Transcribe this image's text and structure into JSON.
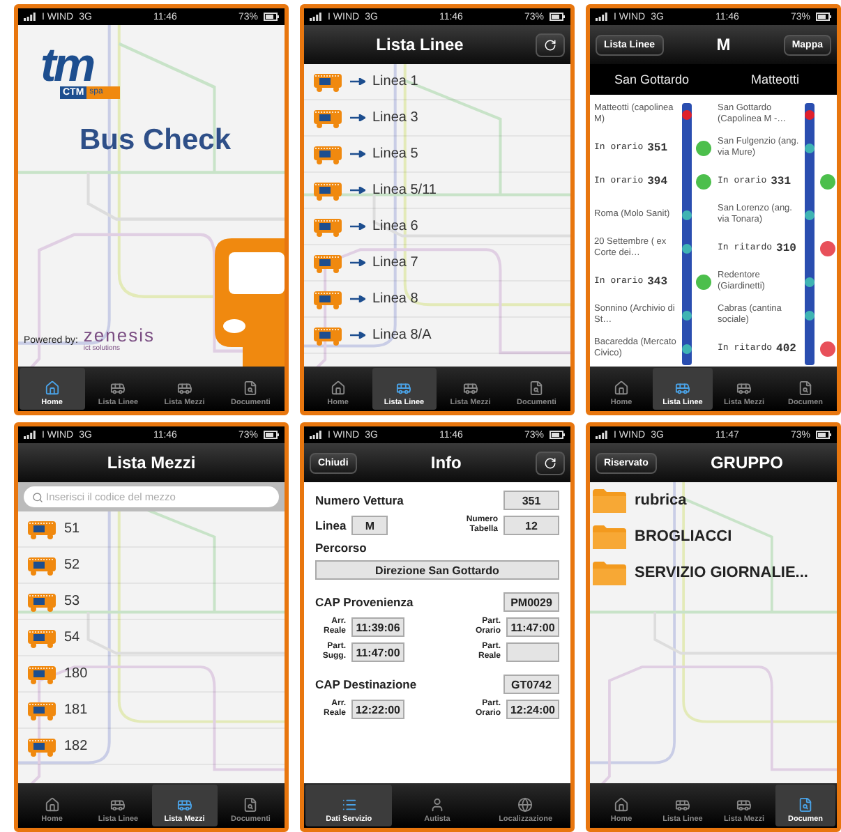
{
  "phones": [
    {
      "kind": "home",
      "status": {
        "carrier": "I WIND",
        "network": "3G",
        "time": "11:46",
        "battery": "73%"
      },
      "logo": {
        "mark": "tm",
        "name": "CTM",
        "suffix": "spa"
      },
      "title": "Bus Check",
      "powered": "Powered by:",
      "brand": "zenesis",
      "brand_sub": "ict solutions",
      "tabs": [
        {
          "label": "Home",
          "selected": true
        },
        {
          "label": "Lista Linee",
          "selected": false
        },
        {
          "label": "Lista Mezzi",
          "selected": false
        },
        {
          "label": "Documenti",
          "selected": false
        }
      ]
    },
    {
      "kind": "lines",
      "status": {
        "carrier": "I WIND",
        "network": "3G",
        "time": "11:46",
        "battery": "73%"
      },
      "nav": {
        "title": "Lista Linee",
        "refresh": true
      },
      "items": [
        "Linea 1",
        "Linea 3",
        "Linea 5",
        "Linea 5/11",
        "Linea 6",
        "Linea 7",
        "Linea 8",
        "Linea 8/A"
      ],
      "tabs": [
        {
          "label": "Home",
          "selected": false
        },
        {
          "label": "Lista Linee",
          "selected": true
        },
        {
          "label": "Lista Mezzi",
          "selected": false
        },
        {
          "label": "Documenti",
          "selected": false
        }
      ]
    },
    {
      "kind": "timeline",
      "status": {
        "carrier": "I WIND",
        "network": "3G",
        "time": "11:46",
        "battery": "73%"
      },
      "nav": {
        "back": "Lista Linee",
        "title": "M",
        "action": "Mappa"
      },
      "columns": [
        {
          "heading": "San Gottardo",
          "items": [
            {
              "kind": "terminal",
              "text": "Matteotti (capolinea M)"
            },
            {
              "kind": "bus",
              "status": "In orario",
              "number": "351",
              "color": "#4cbf4c"
            },
            {
              "kind": "bus",
              "status": "In orario",
              "number": "394",
              "color": "#4cbf4c"
            },
            {
              "kind": "stop",
              "text": "Roma (Molo Sanit)"
            },
            {
              "kind": "stop",
              "text": "20 Settembre ( ex Corte dei…"
            },
            {
              "kind": "bus",
              "status": "In orario",
              "number": "343",
              "color": "#4cbf4c"
            },
            {
              "kind": "stop",
              "text": "Sonnino (Archivio di St…"
            },
            {
              "kind": "stop",
              "text": "Bacaredda (Mercato Civico)"
            }
          ]
        },
        {
          "heading": "Matteotti",
          "items": [
            {
              "kind": "terminal",
              "text": "San Gottardo (Capolinea M -…"
            },
            {
              "kind": "stop",
              "text": "San Fulgenzio (ang. via Mure)"
            },
            {
              "kind": "bus",
              "status": "In orario",
              "number": "331",
              "color": "#4cbf4c"
            },
            {
              "kind": "stop",
              "text": "San Lorenzo (ang. via Tonara)"
            },
            {
              "kind": "bus",
              "status": "In ritardo",
              "number": "310",
              "color": "#e8505a"
            },
            {
              "kind": "stop",
              "text": "Redentore (Giardinetti)"
            },
            {
              "kind": "stop",
              "text": "Cabras (cantina sociale)"
            },
            {
              "kind": "bus",
              "status": "In ritardo",
              "number": "402",
              "color": "#e8505a"
            }
          ]
        }
      ],
      "tabs": [
        {
          "label": "Home",
          "selected": false
        },
        {
          "label": "Lista Linee",
          "selected": true
        },
        {
          "label": "Lista Mezzi",
          "selected": false
        },
        {
          "label": "Documen",
          "selected": false
        }
      ]
    },
    {
      "kind": "vehicles",
      "status": {
        "carrier": "I WIND",
        "network": "3G",
        "time": "11:46",
        "battery": "73%"
      },
      "nav": {
        "title": "Lista Mezzi"
      },
      "search": {
        "placeholder": "Inserisci il codice del mezzo"
      },
      "items": [
        "51",
        "52",
        "53",
        "54",
        "180",
        "181",
        "182"
      ],
      "tabs": [
        {
          "label": "Home",
          "selected": false
        },
        {
          "label": "Lista Linee",
          "selected": false
        },
        {
          "label": "Lista Mezzi",
          "selected": true
        },
        {
          "label": "Documenti",
          "selected": false
        }
      ]
    },
    {
      "kind": "info",
      "status": {
        "carrier": "I WIND",
        "network": "3G",
        "time": "11:46",
        "battery": "73%"
      },
      "nav": {
        "back": "Chiudi",
        "title": "Info",
        "refresh": true
      },
      "fields": [
        {
          "kind": "wide",
          "label": "Numero Vettura",
          "value": "351"
        },
        {
          "kind": "pair",
          "label": "Linea",
          "value": "M",
          "label2": "Numero Tabella",
          "value2": "12"
        },
        {
          "kind": "block",
          "label": "Percorso",
          "value": "Direzione San Gottardo"
        },
        {
          "kind": "wide",
          "label": "CAP Provenienza",
          "value": "PM0029"
        },
        {
          "kind": "times",
          "label": "Arr. Reale",
          "value": "11:39:06",
          "label2": "Part. Orario",
          "value2": "11:47:00"
        },
        {
          "kind": "times",
          "label": "Part. Sugg.",
          "value": "11:47:00",
          "label2": "Part. Reale"
        },
        {
          "kind": "wide",
          "label": "CAP Destinazione",
          "value": "GT0742"
        },
        {
          "kind": "times",
          "label": "Arr. Reale",
          "value": "12:22:00",
          "label2": "Part. Orario",
          "value2": "12:24:00"
        }
      ],
      "tabs": [
        {
          "label": "Dati Servizio",
          "selected": true
        },
        {
          "label": "Autista",
          "selected": false
        },
        {
          "label": "Localizzazione",
          "selected": false
        }
      ]
    },
    {
      "kind": "folders",
      "status": {
        "carrier": "I WIND",
        "network": "3G",
        "time": "11:47",
        "battery": "73%"
      },
      "nav": {
        "back": "Riservato",
        "title": "GRUPPO"
      },
      "items": [
        "rubrica",
        "BROGLIACCI",
        "SERVIZIO GIORNALIE..."
      ],
      "tabs": [
        {
          "label": "Home",
          "selected": false
        },
        {
          "label": "Lista Linee",
          "selected": false
        },
        {
          "label": "Lista Mezzi",
          "selected": false
        },
        {
          "label": "Documen",
          "selected": true
        }
      ]
    }
  ]
}
